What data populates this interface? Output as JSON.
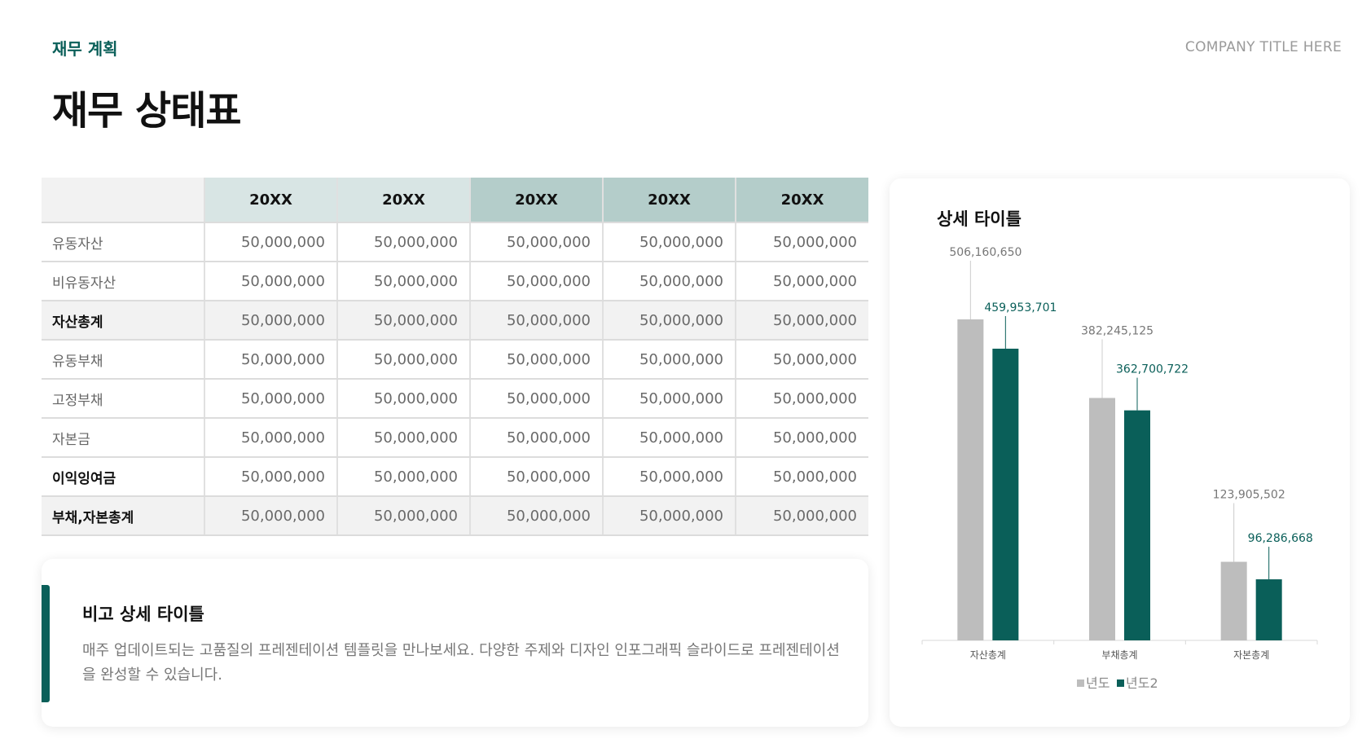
{
  "header": {
    "section_label": "재무 계획",
    "company_title": "COMPANY TITLE HERE",
    "page_title": "재무 상태표"
  },
  "table": {
    "columns": [
      "20XX",
      "20XX",
      "20XX",
      "20XX",
      "20XX"
    ],
    "rows": [
      {
        "label": "유동자산",
        "values": [
          "50,000,000",
          "50,000,000",
          "50,000,000",
          "50,000,000",
          "50,000,000"
        ]
      },
      {
        "label": "비유동자산",
        "values": [
          "50,000,000",
          "50,000,000",
          "50,000,000",
          "50,000,000",
          "50,000,000"
        ]
      },
      {
        "label": "자산총계",
        "values": [
          "50,000,000",
          "50,000,000",
          "50,000,000",
          "50,000,000",
          "50,000,000"
        ]
      },
      {
        "label": "유동부채",
        "values": [
          "50,000,000",
          "50,000,000",
          "50,000,000",
          "50,000,000",
          "50,000,000"
        ]
      },
      {
        "label": "고정부채",
        "values": [
          "50,000,000",
          "50,000,000",
          "50,000,000",
          "50,000,000",
          "50,000,000"
        ]
      },
      {
        "label": "자본금",
        "values": [
          "50,000,000",
          "50,000,000",
          "50,000,000",
          "50,000,000",
          "50,000,000"
        ]
      },
      {
        "label": "이익잉여금",
        "values": [
          "50,000,000",
          "50,000,000",
          "50,000,000",
          "50,000,000",
          "50,000,000"
        ]
      },
      {
        "label": "부채,자본총계",
        "values": [
          "50,000,000",
          "50,000,000",
          "50,000,000",
          "50,000,000",
          "50,000,000"
        ]
      }
    ]
  },
  "remark": {
    "title": "비고 상세 타이틀",
    "text": "매주 업데이트되는 고품질의 프레젠테이션 템플릿을 만나보세요. 다양한 주제와 디자인 인포그래픽 슬라이드로 프레젠테이션을 완성할 수 있습니다."
  },
  "chart_card": {
    "title": "상세 타이틀"
  },
  "colors": {
    "accent": "#0a5f59",
    "series1": "#bdbdbd",
    "series2": "#0a5f59",
    "header_light": "#d8e5e4",
    "header_dark": "#b4cdca"
  },
  "chart_data": {
    "type": "bar",
    "title": "상세 타이틀",
    "categories": [
      "자산총계",
      "부채총계",
      "자본총계"
    ],
    "series": [
      {
        "name": "년도",
        "values": [
          506160650,
          382245125,
          123905502
        ]
      },
      {
        "name": "년도2",
        "values": [
          459953701,
          362700722,
          96286668
        ]
      }
    ],
    "value_labels": [
      [
        "506,160,650",
        "382,245,125",
        "123,905,502"
      ],
      [
        "459,953,701",
        "362,700,722",
        "96,286,668"
      ]
    ],
    "ylim": [
      0,
      506160650
    ],
    "grid": false,
    "legend_position": "bottom"
  }
}
